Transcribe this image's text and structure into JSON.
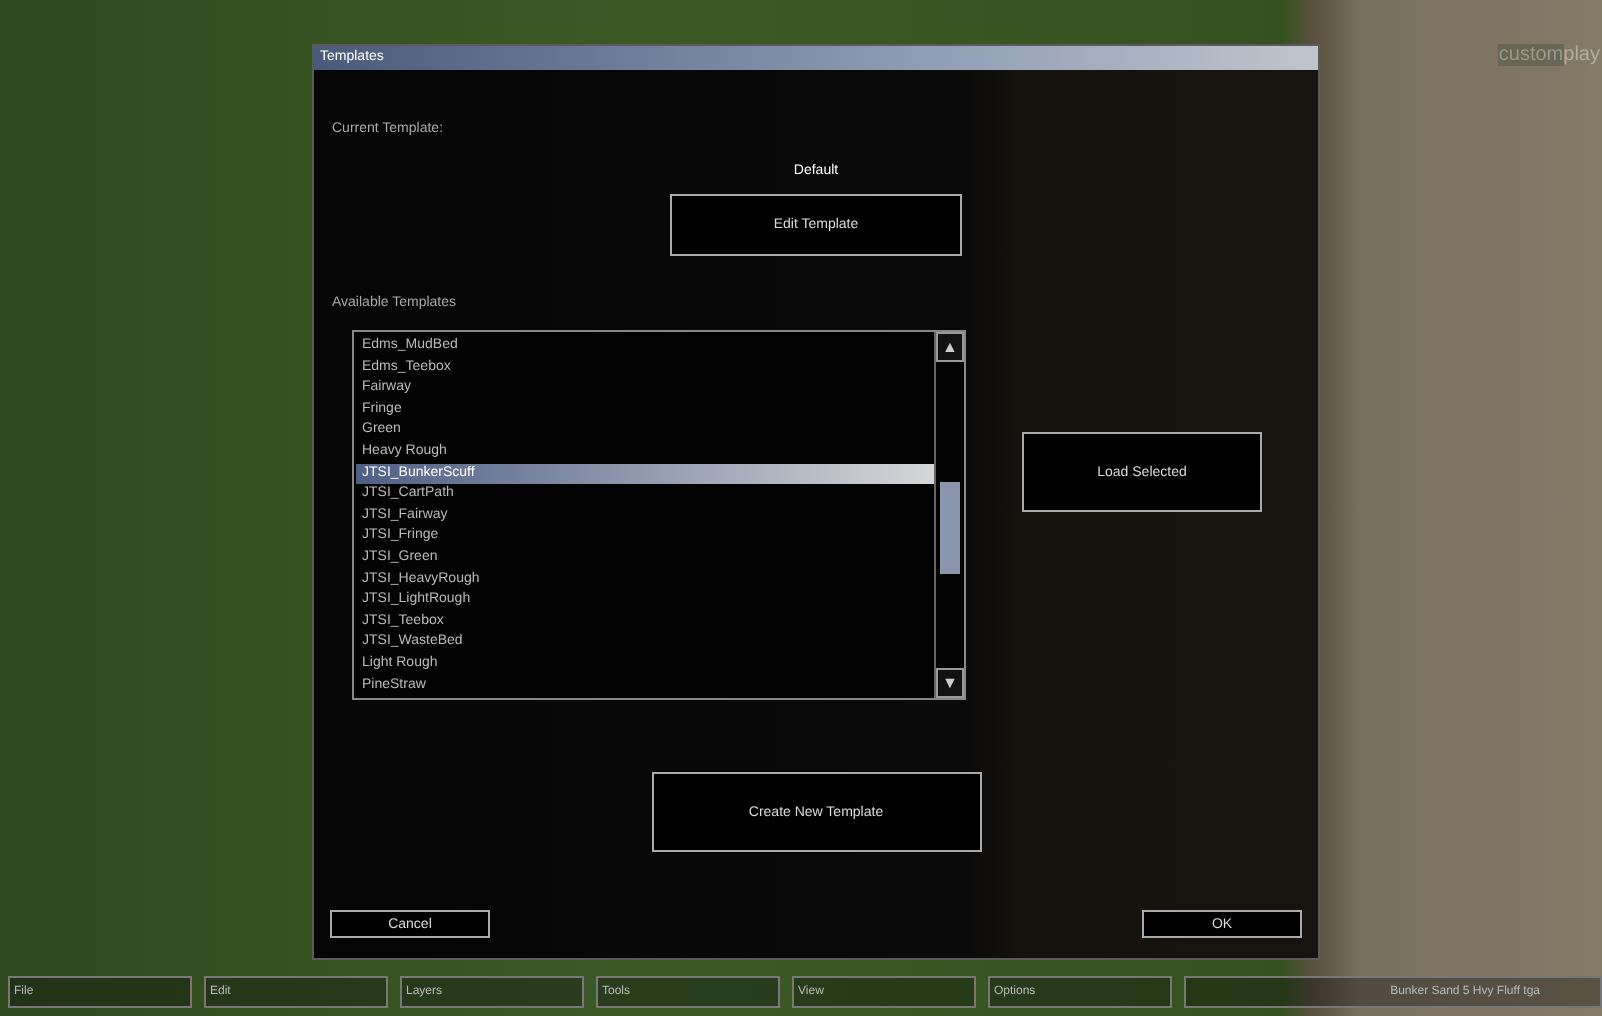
{
  "logo": {
    "part_1": "custom",
    "part_2": "play"
  },
  "dialog": {
    "title": "Templates",
    "current_label": "Current Template:",
    "current_value": "Default",
    "edit_button": "Edit Template",
    "available_label": "Available Templates",
    "templates": [
      {
        "label": "Edms_MudBed",
        "selected": false
      },
      {
        "label": "Edms_Teebox",
        "selected": false
      },
      {
        "label": "Fairway",
        "selected": false
      },
      {
        "label": "Fringe",
        "selected": false
      },
      {
        "label": "Green",
        "selected": false
      },
      {
        "label": "Heavy Rough",
        "selected": false
      },
      {
        "label": "JTSI_BunkerScuff",
        "selected": true
      },
      {
        "label": "JTSI_CartPath",
        "selected": false
      },
      {
        "label": "JTSI_Fairway",
        "selected": false
      },
      {
        "label": "JTSI_Fringe",
        "selected": false
      },
      {
        "label": "JTSI_Green",
        "selected": false
      },
      {
        "label": "JTSI_HeavyRough",
        "selected": false
      },
      {
        "label": "JTSI_LightRough",
        "selected": false
      },
      {
        "label": "JTSI_Teebox",
        "selected": false
      },
      {
        "label": "JTSI_WasteBed",
        "selected": false
      },
      {
        "label": "Light Rough",
        "selected": false
      },
      {
        "label": "PineStraw",
        "selected": false
      }
    ],
    "scroll_up": "▲",
    "scroll_down": "▼",
    "load_button": "Load Selected",
    "create_button": "Create New Template",
    "cancel_button": "Cancel",
    "ok_button": "OK"
  },
  "menu_bar": [
    "File",
    "Edit",
    "Layers",
    "Tools",
    "View",
    "Options"
  ],
  "status": "Bunker Sand 5 Hvy Fluff tga"
}
